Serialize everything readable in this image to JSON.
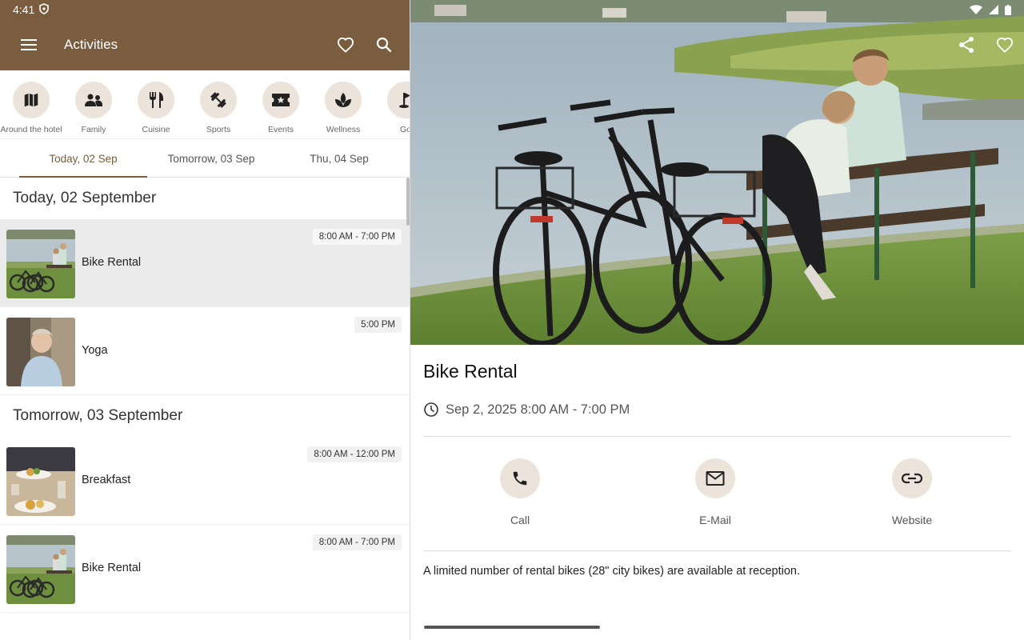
{
  "status_bar": {
    "time": "4:41"
  },
  "app_bar": {
    "title": "Activities"
  },
  "categories": [
    {
      "label": "Around the hotel",
      "icon": "map-icon"
    },
    {
      "label": "Family",
      "icon": "family-icon"
    },
    {
      "label": "Cuisine",
      "icon": "cutlery-icon"
    },
    {
      "label": "Sports",
      "icon": "dumbbell-icon"
    },
    {
      "label": "Events",
      "icon": "ticket-icon"
    },
    {
      "label": "Wellness",
      "icon": "spa-icon"
    },
    {
      "label": "Go",
      "icon": "golf-icon"
    }
  ],
  "day_tabs": [
    {
      "label": "Today, 02 Sep",
      "active": true
    },
    {
      "label": "Tomorrow, 03 Sep",
      "active": false
    },
    {
      "label": "Thu, 04 Sep",
      "active": false
    }
  ],
  "sections": [
    {
      "heading": "Today, 02 September",
      "items": [
        {
          "name": "Bike Rental",
          "time": "8:00 AM - 7:00 PM",
          "selected": true,
          "thumb": "bikes"
        },
        {
          "name": "Yoga",
          "time": "5:00 PM",
          "selected": false,
          "thumb": "yoga"
        }
      ]
    },
    {
      "heading": "Tomorrow, 03 September",
      "items": [
        {
          "name": "Breakfast",
          "time": "8:00 AM - 12:00 PM",
          "selected": false,
          "thumb": "food"
        },
        {
          "name": "Bike Rental",
          "time": "8:00 AM - 7:00 PM",
          "selected": false,
          "thumb": "bikes"
        }
      ]
    }
  ],
  "detail": {
    "title": "Bike Rental",
    "datetime": "Sep 2, 2025 8:00 AM - 7:00 PM",
    "actions": {
      "call": "Call",
      "email": "E-Mail",
      "website": "Website"
    },
    "description": "A limited number of rental bikes (28\" city bikes) are available at reception."
  },
  "colors": {
    "primary": "#7a5c3e",
    "chip_bg": "#ece3da",
    "selected_row": "#ebebeb"
  }
}
